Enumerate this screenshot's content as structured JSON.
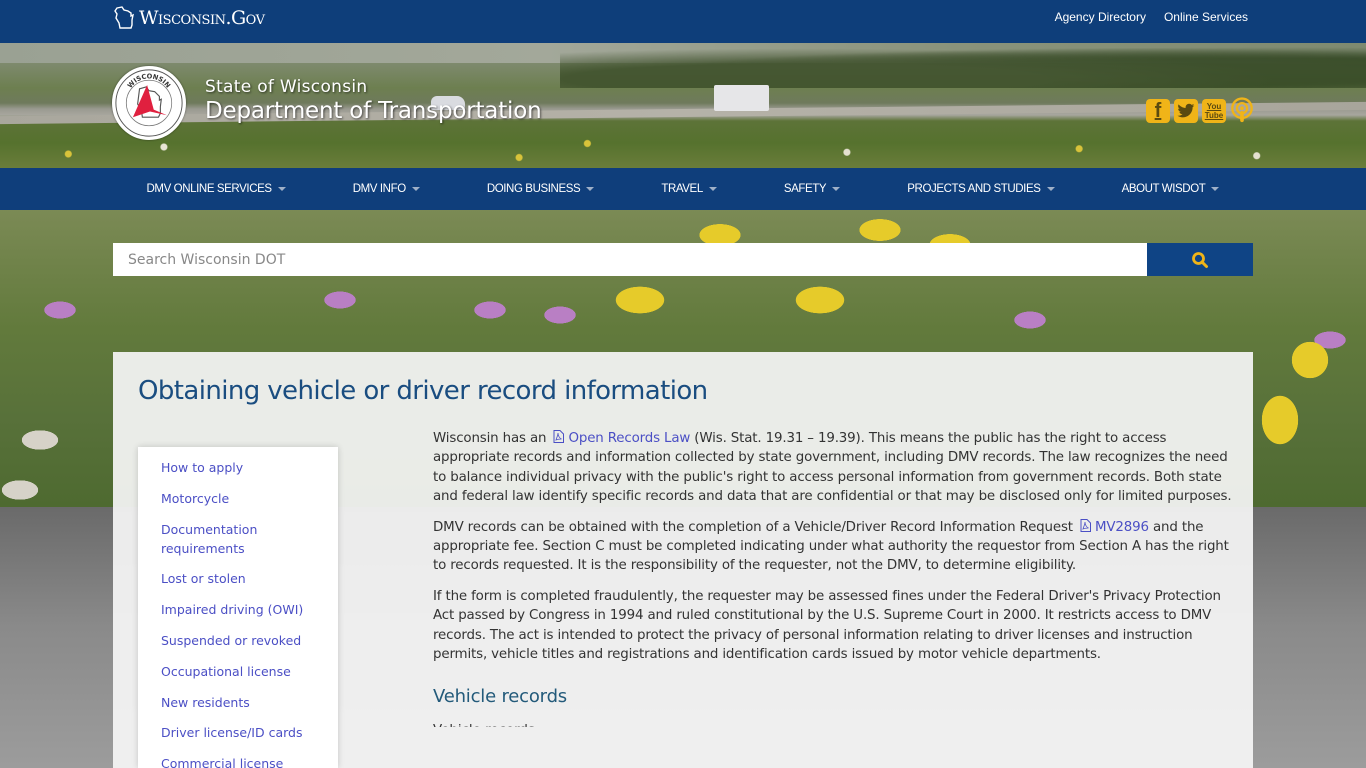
{
  "topbar": {
    "brand": "Wisconsin.Gov",
    "links": [
      "Agency Directory",
      "Online Services"
    ]
  },
  "header": {
    "state_line": "State of Wisconsin",
    "dept_line": "Department of Transportation",
    "seal_top_text": "WISCONSIN",
    "seal_bottom_text": "DEPARTMENT OF TRANSPORTATION",
    "social_icons": [
      "facebook-icon",
      "twitter-icon",
      "youtube-icon",
      "podcast-icon"
    ],
    "youtube_label_top": "You",
    "youtube_label_bottom": "Tube",
    "facebook_glyph": "f"
  },
  "nav": {
    "items": [
      "DMV ONLINE SERVICES",
      "DMV INFO",
      "DOING BUSINESS",
      "TRAVEL",
      "SAFETY",
      "PROJECTS AND STUDIES",
      "ABOUT WISDOT"
    ]
  },
  "search": {
    "placeholder": "Search Wisconsin DOT",
    "value": ""
  },
  "page": {
    "title": "Obtaining vehicle or driver record information"
  },
  "sidebar": {
    "items": [
      "How to apply",
      "Motorcycle",
      "Documentation requirements",
      "Lost or stolen",
      "Impaired driving (OWI)",
      "Suspended or revoked",
      "Occupational license",
      "New residents",
      "Driver license/ID cards",
      "Commercial license"
    ]
  },
  "article": {
    "p1_before": "Wisconsin has an ",
    "p1_link": "Open Records Law",
    "p1_after": " (Wis. Stat. 19.31 – 19.39). This means the public has the right to access appropriate records and information collected by state government, including DMV records. The law recognizes the need to balance individual privacy with the public's right to access personal information from government records. Both state and federal law identify specific records and data that are confidential or that may be disclosed only for limited purposes.",
    "p2_before": "DMV records can be obtained with the completion of a Vehicle/Driver Record Information Request ",
    "p2_link": "MV2896",
    "p2_after": " and the appropriate fee. Section C must be completed indicating under what authority the requestor from Section A has the right to records requested. It is the responsibility of the requester, not the DMV, to determine eligibility.",
    "p3": "If the form is completed fraudulently, the requester may be assessed fines under the Federal Driver's Privacy Protection Act passed by Congress in 1994 and ruled constitutional by the U.S. Supreme Court in 2000. It restricts access to DMV records. The act is intended to protect the privacy of personal information relating to driver licenses and instruction permits, vehicle titles and registrations and identification cards issued by motor vehicle departments.",
    "h2": "Vehicle records",
    "next_line": "Vehicle records"
  },
  "colors": {
    "topbar_bg": "#0e3e7a",
    "nav_bg": "#0f3e7b",
    "search_button_bg": "#0f4485",
    "accent_gold": "#f0b418",
    "link": "#4b4fc5",
    "title": "#1a4d80"
  }
}
